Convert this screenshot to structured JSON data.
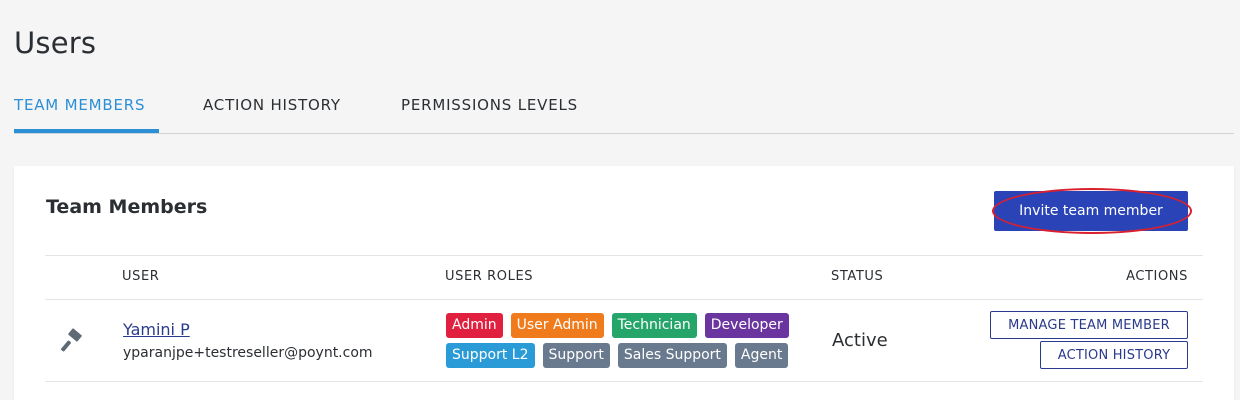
{
  "page": {
    "title": "Users"
  },
  "tabs": [
    {
      "label": "TEAM MEMBERS",
      "active": true
    },
    {
      "label": "ACTION HISTORY",
      "active": false
    },
    {
      "label": "PERMISSIONS LEVELS",
      "active": false
    }
  ],
  "card": {
    "title": "Team Members",
    "invite_label": "Invite team member"
  },
  "table": {
    "headers": {
      "user": "USER",
      "roles": "USER ROLES",
      "status": "STATUS",
      "actions": "ACTIONS"
    },
    "rows": [
      {
        "icon": "gavel-icon",
        "name": "Yamini P",
        "email": "yparanjpe+testreseller@poynt.com",
        "roles": [
          {
            "label": "Admin",
            "color": "#e0203e"
          },
          {
            "label": "User Admin",
            "color": "#f07b1c"
          },
          {
            "label": "Technician",
            "color": "#25a56a"
          },
          {
            "label": "Developer",
            "color": "#6b35a0"
          },
          {
            "label": "Support L2",
            "color": "#2a9bd6"
          },
          {
            "label": "Support",
            "color": "#6a7a8e"
          },
          {
            "label": "Sales Support",
            "color": "#6a7a8e"
          },
          {
            "label": "Agent",
            "color": "#6a7a8e"
          }
        ],
        "status": "Active",
        "manage_label": "MANAGE TEAM MEMBER",
        "history_label": "ACTION HISTORY"
      }
    ]
  },
  "colors": {
    "accent": "#2b8fd6",
    "primary_button": "#2a44b8",
    "link": "#2a3a8c",
    "highlight_ring": "#d8202e"
  }
}
